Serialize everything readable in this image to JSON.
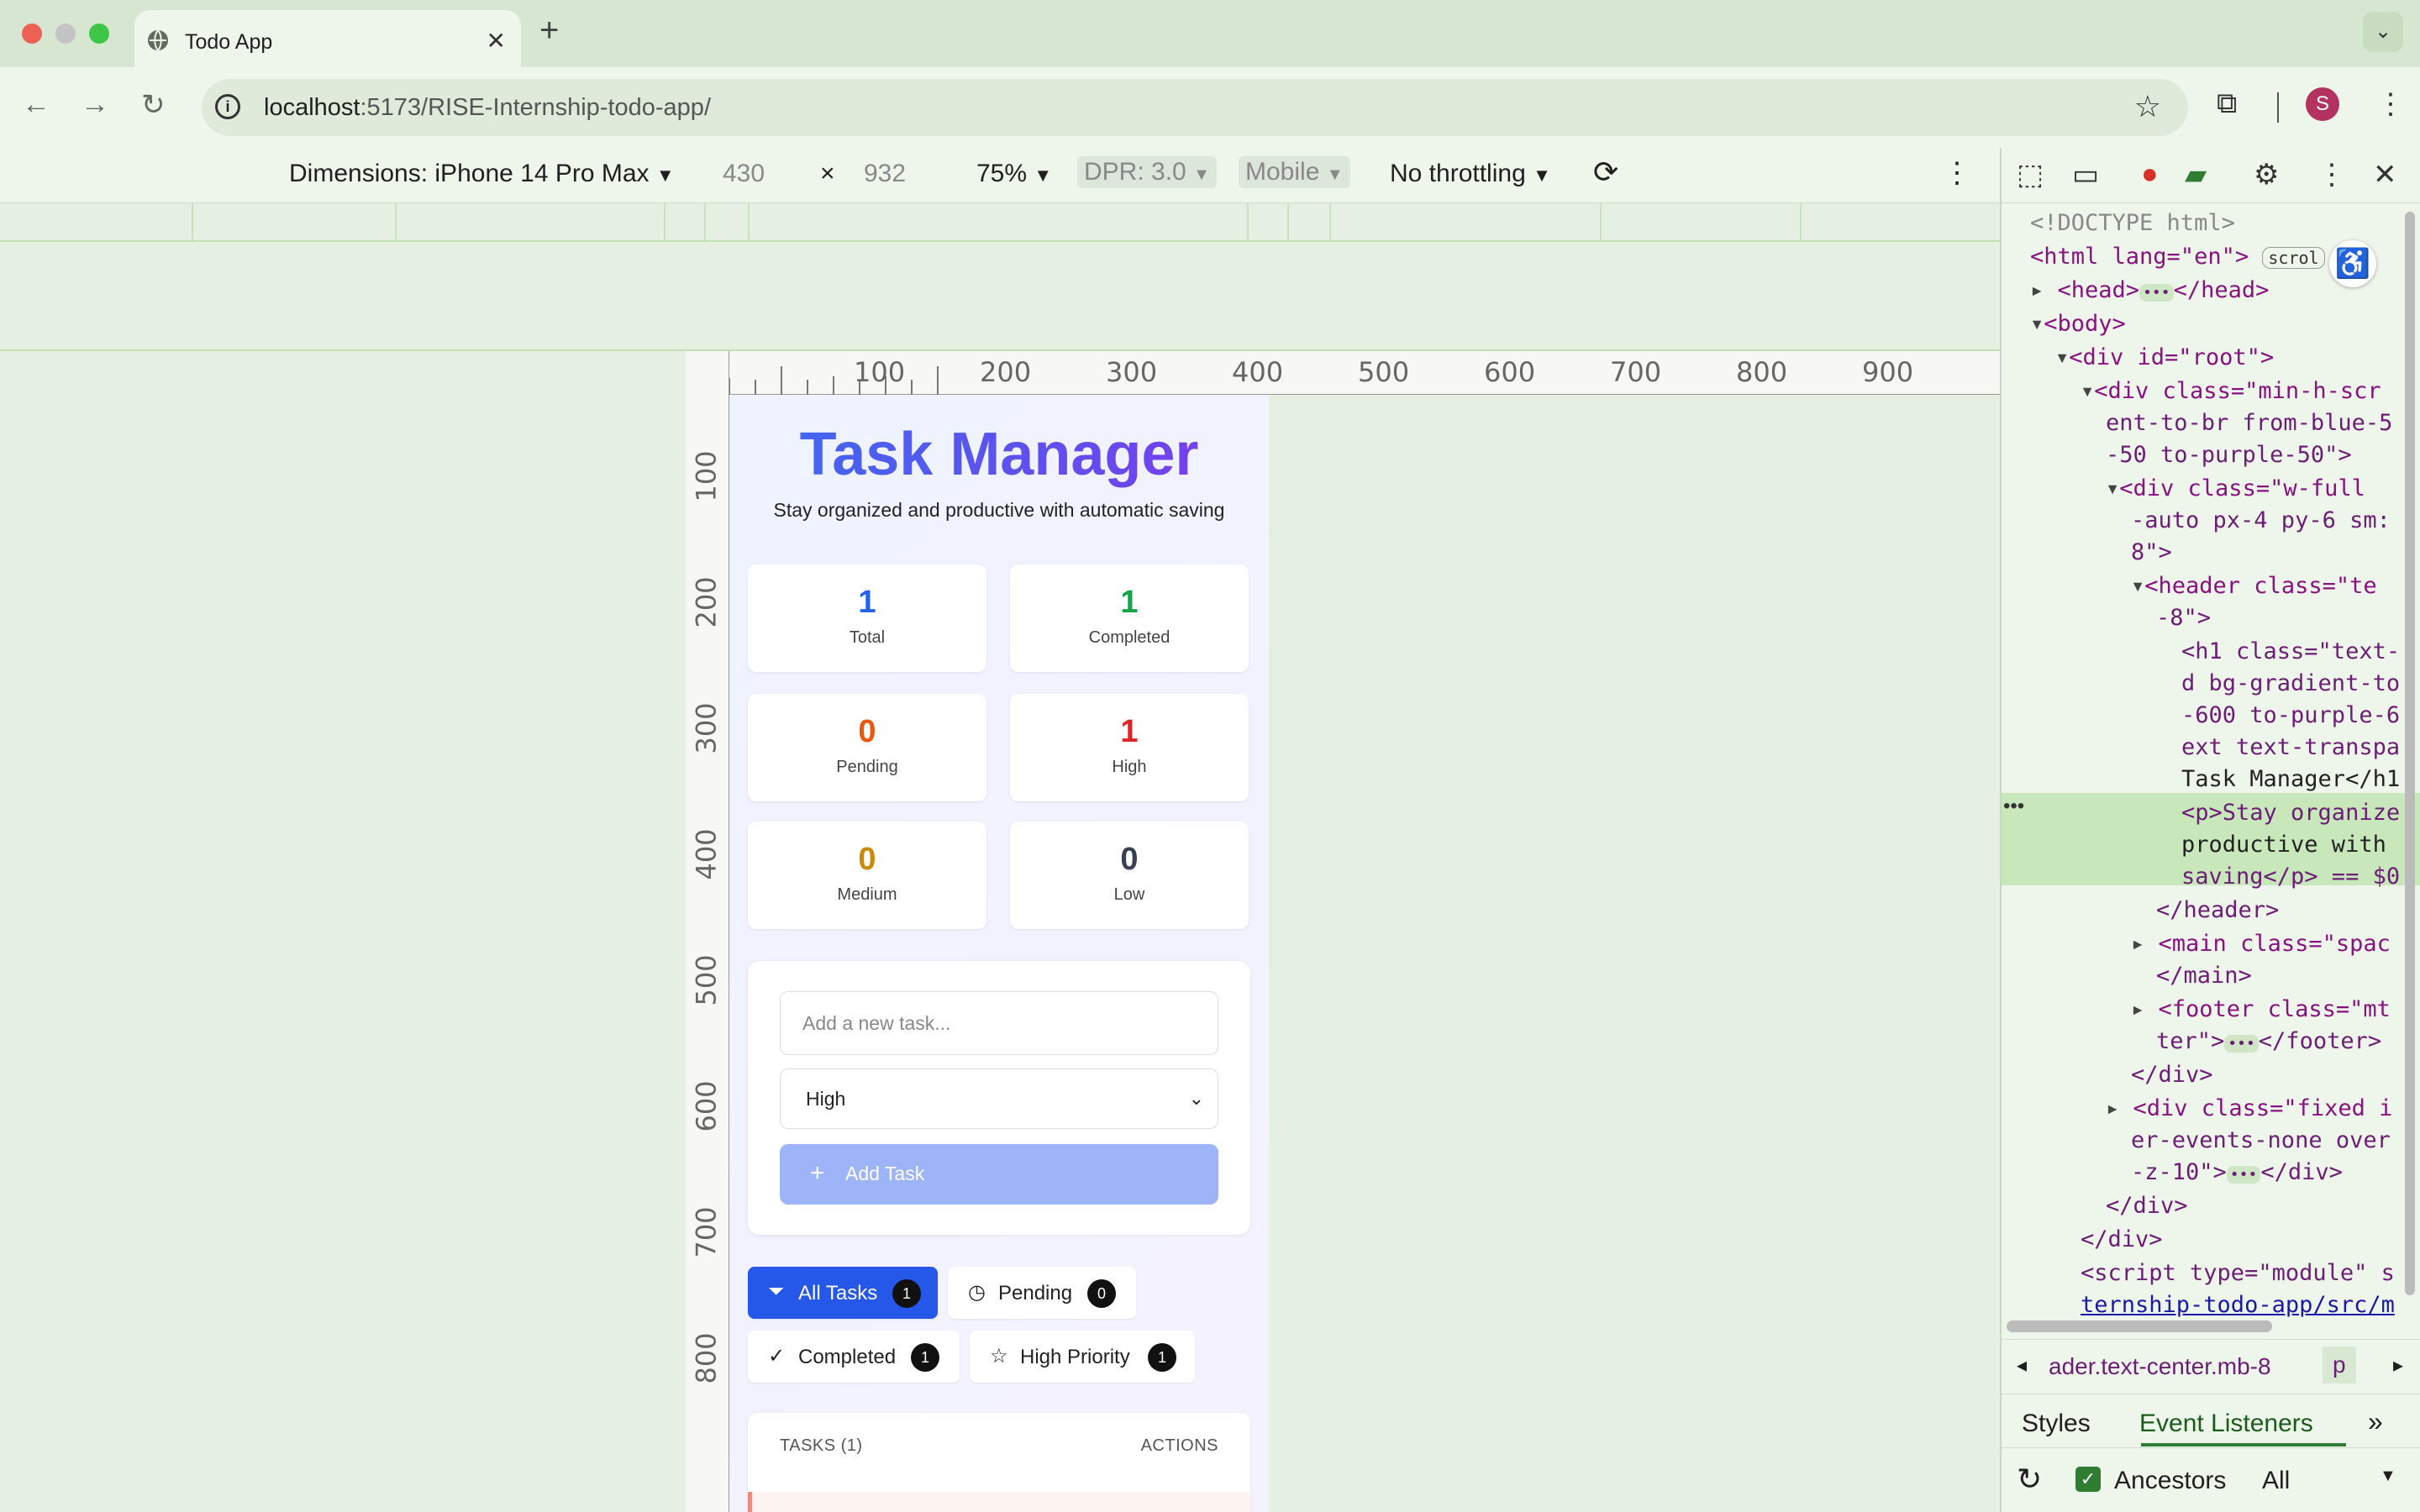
{
  "browser": {
    "tab_title": "Todo App",
    "url_prefix": "localhost",
    "url_rest": ":5173/RISE-Internship-todo-app/",
    "profile_initial": "S"
  },
  "device_toolbar": {
    "dimensions_label": "Dimensions: iPhone 14 Pro Max",
    "width": "430",
    "times": "×",
    "height": "932",
    "zoom": "75%",
    "dpr": "DPR: 3.0",
    "mode": "Mobile",
    "throttling": "No throttling"
  },
  "ruler": {
    "top_labels": [
      "100",
      "200",
      "300",
      "400",
      "500",
      "600",
      "700",
      "800",
      "900"
    ],
    "left_labels": [
      "100",
      "200",
      "300",
      "400",
      "500",
      "600",
      "700",
      "800"
    ]
  },
  "app": {
    "title": "Task Manager",
    "subtitle": "Stay organized and productive with automatic saving",
    "stats": [
      {
        "value": "1",
        "label": "Total",
        "color": "#2563eb"
      },
      {
        "value": "1",
        "label": "Completed",
        "color": "#16a34a"
      },
      {
        "value": "0",
        "label": "Pending",
        "color": "#ea580c"
      },
      {
        "value": "1",
        "label": "High",
        "color": "#dc2626"
      },
      {
        "value": "0",
        "label": "Medium",
        "color": "#ca8a04"
      },
      {
        "value": "0",
        "label": "Low",
        "color": "#374151"
      }
    ],
    "form": {
      "placeholder": "Add a new task...",
      "priority_selected": "High",
      "add_label": "Add Task"
    },
    "filters": [
      {
        "label": "All Tasks",
        "count": "1"
      },
      {
        "label": "Pending",
        "count": "0"
      },
      {
        "label": "Completed",
        "count": "1"
      },
      {
        "label": "High Priority",
        "count": "1"
      }
    ],
    "tasks_header": {
      "left": "TASKS (1)",
      "right": "ACTIONS"
    }
  },
  "devtools": {
    "lines": [
      "<!DOCTYPE html>",
      "<html lang=\"en\">",
      "<head>",
      "</head>",
      "<body>",
      "<div id=\"root\">",
      "<div class=\"min-h-scr",
      "ent-to-br from-blue-5",
      "-50 to-purple-50\">",
      "<div class=\"w-full",
      "-auto px-4 py-6 sm:",
      "8\">",
      "<header class=\"te",
      "-8\">",
      "<h1 class=\"text-",
      "d bg-gradient-to",
      "-600 to-purple-6",
      "ext text-transpa",
      "Task Manager</h1",
      "<p>Stay organize",
      "productive with",
      "saving</p> == $0",
      "</header>",
      "<main class=\"spac",
      "</main>",
      "<footer class=\"mt",
      "ter\">",
      "</footer>",
      "</div>",
      "<div class=\"fixed i",
      "er-events-none over",
      "-z-10\">",
      "</div>",
      "</div>",
      "</div>",
      "<script type=\"module\" s",
      "ternship-todo-app/src/m"
    ],
    "scroll_badge": "scrol",
    "breadcrumb": "ader.text-center.mb-8",
    "breadcrumb_tail": "p",
    "tab_styles": "Styles",
    "tab_event_listeners": "Event Listeners",
    "ancestors_label": "Ancestors",
    "filter_value": "All"
  }
}
